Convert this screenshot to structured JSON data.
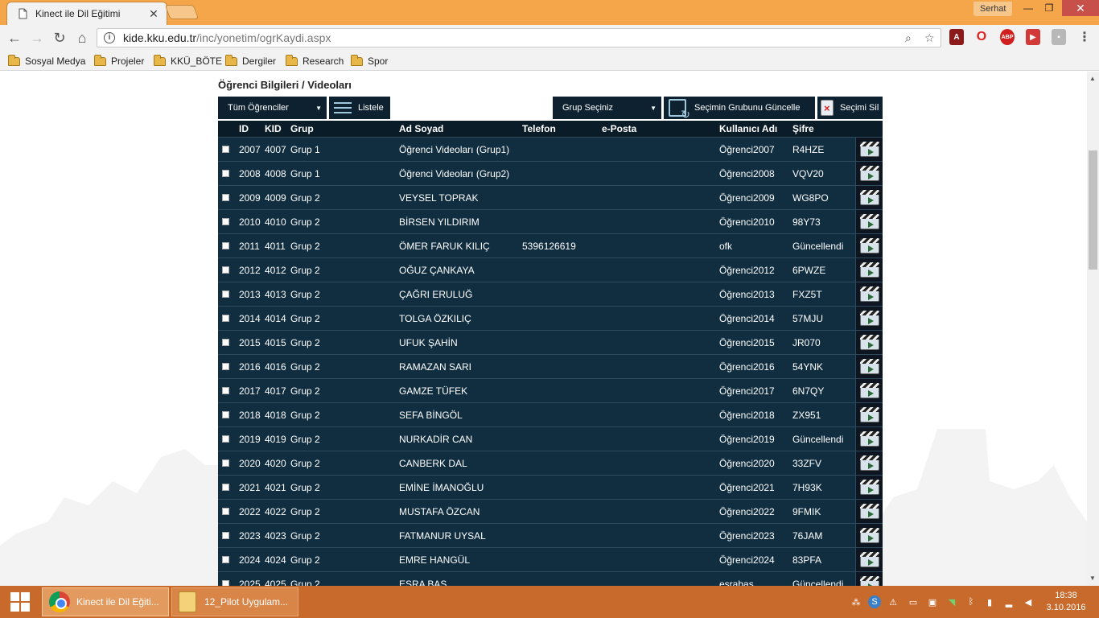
{
  "browser": {
    "tab_title": "Kinect ile Dil Eğitimi",
    "profile": "Serhat",
    "url_host": "kide.kku.edu.tr",
    "url_path": "/inc/yonetim/ogrKaydi.aspx",
    "bookmarks": [
      "Sosyal Medya",
      "Projeler",
      "KKÜ_BÖTE",
      "Dergiler",
      "Research",
      "Spor"
    ]
  },
  "page": {
    "title": "Öğrenci Bilgileri / Videoları",
    "student_filter": "Tüm Öğrenciler",
    "list_button": "Listele",
    "group_select": "Grup Seçiniz",
    "update_group_button": "Seçimin Grubunu Güncelle",
    "delete_button": "Seçimi Sil"
  },
  "grid": {
    "headers": [
      "ID",
      "KID",
      "Grup",
      "Ad Soyad",
      "Telefon",
      "e-Posta",
      "Kullanıcı Adı",
      "Şifre"
    ],
    "rows": [
      [
        "2007",
        "4007",
        "Grup 1",
        "Öğrenci Videoları (Grup1)",
        "",
        "",
        "Öğrenci2007",
        "R4HZE"
      ],
      [
        "2008",
        "4008",
        "Grup 1",
        "Öğrenci Videoları (Grup2)",
        "",
        "",
        "Öğrenci2008",
        "VQV20"
      ],
      [
        "2009",
        "4009",
        "Grup 2",
        "VEYSEL TOPRAK",
        "",
        "",
        "Öğrenci2009",
        "WG8PO"
      ],
      [
        "2010",
        "4010",
        "Grup 2",
        "BİRSEN YILDIRIM",
        "",
        "",
        "Öğrenci2010",
        "98Y73"
      ],
      [
        "2011",
        "4011",
        "Grup 2",
        "ÖMER FARUK KILIÇ",
        "5396126619",
        "",
        "ofk",
        "Güncellendi"
      ],
      [
        "2012",
        "4012",
        "Grup 2",
        "OĞUZ ÇANKAYA",
        "",
        "",
        "Öğrenci2012",
        "6PWZE"
      ],
      [
        "2013",
        "4013",
        "Grup 2",
        "ÇAĞRI ERULUĞ",
        "",
        "",
        "Öğrenci2013",
        "FXZ5T"
      ],
      [
        "2014",
        "4014",
        "Grup 2",
        "TOLGA ÖZKILIÇ",
        "",
        "",
        "Öğrenci2014",
        "57MJU"
      ],
      [
        "2015",
        "4015",
        "Grup 2",
        "UFUK ŞAHİN",
        "",
        "",
        "Öğrenci2015",
        "JR070"
      ],
      [
        "2016",
        "4016",
        "Grup 2",
        "RAMAZAN SARI",
        "",
        "",
        "Öğrenci2016",
        "54YNK"
      ],
      [
        "2017",
        "4017",
        "Grup 2",
        "GAMZE TÜFEK",
        "",
        "",
        "Öğrenci2017",
        "6N7QY"
      ],
      [
        "2018",
        "4018",
        "Grup 2",
        "SEFA BİNGÖL",
        "",
        "",
        "Öğrenci2018",
        "ZX951"
      ],
      [
        "2019",
        "4019",
        "Grup 2",
        "NURKADİR CAN",
        "",
        "",
        "Öğrenci2019",
        "Güncellendi"
      ],
      [
        "2020",
        "4020",
        "Grup 2",
        "CANBERK DAL",
        "",
        "",
        "Öğrenci2020",
        "33ZFV"
      ],
      [
        "2021",
        "4021",
        "Grup 2",
        "EMİNE İMANOĞLU",
        "",
        "",
        "Öğrenci2021",
        "7H93K"
      ],
      [
        "2022",
        "4022",
        "Grup 2",
        "MUSTAFA ÖZCAN",
        "",
        "",
        "Öğrenci2022",
        "9FMIK"
      ],
      [
        "2023",
        "4023",
        "Grup 2",
        "FATMANUR UYSAL",
        "",
        "",
        "Öğrenci2023",
        "76JAM"
      ],
      [
        "2024",
        "4024",
        "Grup 2",
        "EMRE HANGÜL",
        "",
        "",
        "Öğrenci2024",
        "83PFA"
      ],
      [
        "2025",
        "4025",
        "Grup 2",
        "ESRA BAŞ",
        "",
        "",
        "esrabas",
        "Güncellendi"
      ]
    ]
  },
  "taskbar": {
    "items": [
      "Kinect ile Dil Eğiti...",
      "12_Pilot Uygulam..."
    ],
    "time": "18:38",
    "date": "3.10.2016"
  },
  "colors": {
    "tabstrip": "#f5a64a",
    "grid_header": "#0b1c29",
    "grid_row": "#102e40",
    "taskbar": "#c76a2b"
  }
}
